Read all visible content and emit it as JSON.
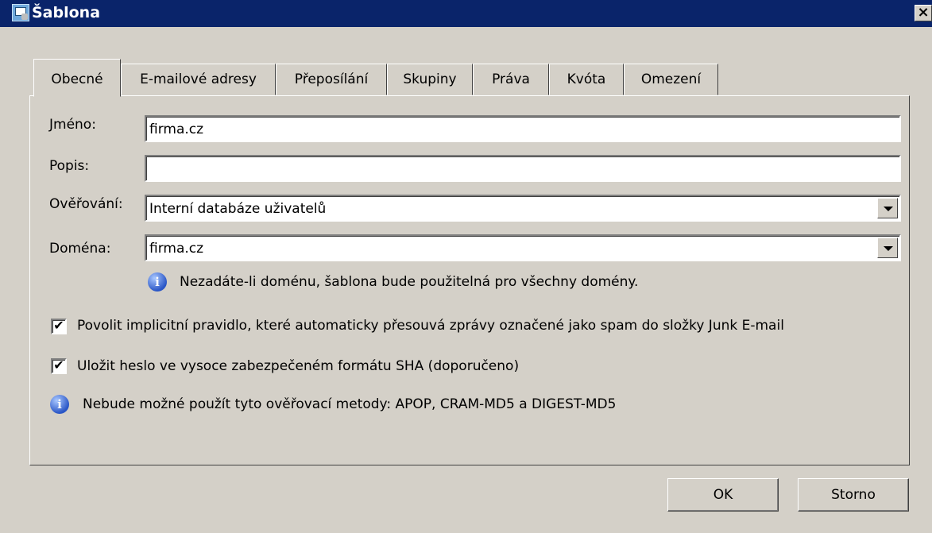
{
  "window": {
    "title": "Šablona",
    "close_label": "×"
  },
  "tabs": [
    {
      "label": "Obecné",
      "active": true
    },
    {
      "label": "E-mailové adresy"
    },
    {
      "label": "Přeposílání"
    },
    {
      "label": "Skupiny"
    },
    {
      "label": "Práva"
    },
    {
      "label": "Kvóta"
    },
    {
      "label": "Omezení"
    }
  ],
  "form": {
    "name_label": "Jméno:",
    "name_value": "firma.cz",
    "description_label": "Popis:",
    "description_value": "",
    "auth_label": "Ověřování:",
    "auth_value": "Interní databáze uživatelů",
    "domain_label": "Doména:",
    "domain_value": "firma.cz",
    "domain_info": "Nezadáte-li doménu, šablona bude použitelná pro všechny domény.",
    "spam_rule_label": "Povolit implicitní pravidlo, které automaticky přesouvá zprávy označené jako spam do složky Junk E-mail",
    "spam_rule_checked": true,
    "sha_label": "Uložit heslo ve vysoce zabezpečeném formátu SHA (doporučeno)",
    "sha_checked": true,
    "sha_info": "Nebude možné použít tyto ověřovací metody: APOP, CRAM-MD5 a DIGEST-MD5",
    "check_mark": "✔",
    "info_glyph": "i"
  },
  "buttons": {
    "ok": "OK",
    "cancel": "Storno"
  },
  "colors": {
    "titlebar": "#0a246a",
    "dialog_bg": "#d4d0c8",
    "info_icon": "#2a56c6"
  },
  "icons": [
    "app-icon",
    "close-icon",
    "info-icon",
    "dropdown-arrow-icon",
    "checkbox-check-icon"
  ]
}
